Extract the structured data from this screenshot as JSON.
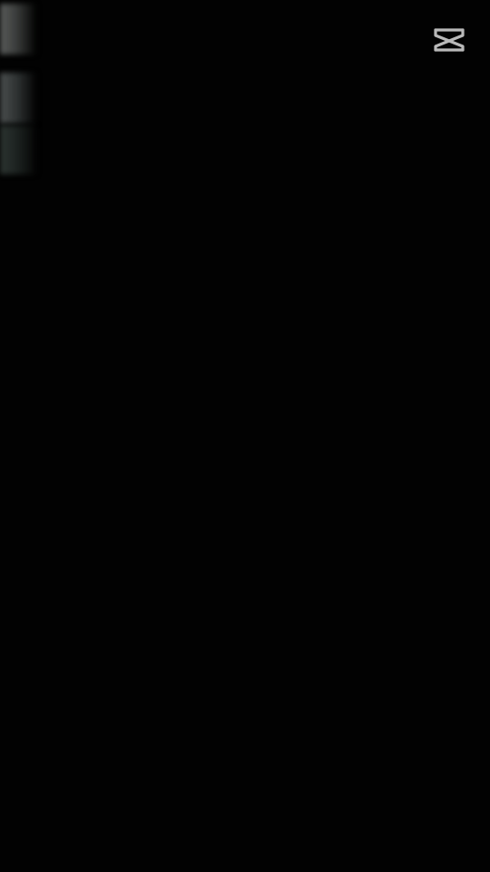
{
  "screen": {
    "background_color": "#020202"
  },
  "thumbnails": [
    {
      "icon": "video-thumbnail"
    },
    {
      "icon": "video-thumbnail"
    },
    {
      "icon": "video-thumbnail"
    }
  ],
  "watermark": {
    "icon": "capcut-logo-icon",
    "color": "#b9b9b9"
  }
}
